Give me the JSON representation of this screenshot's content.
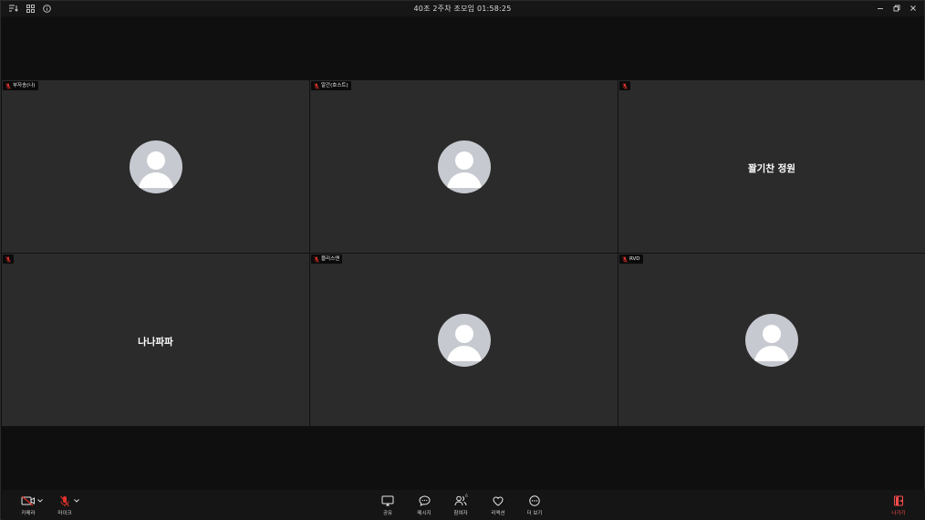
{
  "window": {
    "title": "40조 2주차 조모임 01:58:25"
  },
  "colors": {
    "background": "#0f0f0f",
    "tile": "#2b2b2b",
    "avatar": "#c6c9cf",
    "muted_red": "#e0322b",
    "leave_red": "#ff4d4d"
  },
  "participants": [
    {
      "name": "부자송(나)",
      "display": "avatar"
    },
    {
      "name": "알간(호스트)",
      "display": "avatar"
    },
    {
      "name": "",
      "display": "text",
      "text": "꽐기찬 정원"
    },
    {
      "name": "",
      "display": "text",
      "text": "나나파파"
    },
    {
      "name": "블리스멘",
      "display": "avatar"
    },
    {
      "name": "RVD",
      "display": "avatar"
    }
  ],
  "toolbar": {
    "camera_label": "카메라",
    "mic_label": "마이크",
    "share_label": "공유",
    "chat_label": "메시지",
    "participants_label": "참여자",
    "participants_count": "6",
    "reactions_label": "리액션",
    "more_label": "더 보기",
    "leave_label": "나가기"
  },
  "icons": {
    "top_left": [
      "list-sort-icon",
      "grid-view-icon",
      "info-icon"
    ],
    "window_controls": [
      "minimize-icon",
      "restore-icon",
      "close-icon"
    ]
  }
}
